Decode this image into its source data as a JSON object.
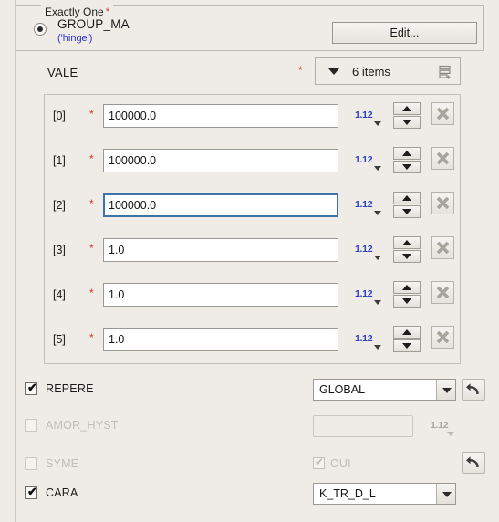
{
  "group": {
    "legend": "Exactly One",
    "legend_required": "*",
    "radio_label": "GROUP_MA",
    "radio_sublabel": "('hinge')",
    "radio_selected": true,
    "edit_button": "Edit..."
  },
  "vale": {
    "label": "VALE",
    "required": "*",
    "count_text": "6 items",
    "list_icon": "list-add-icon",
    "dropdown_icon": "triangle-down-icon"
  },
  "list": {
    "required_marker": "*",
    "type_badge": "1.12",
    "delete_icon": "x-icon",
    "rows": [
      {
        "index": "[0]",
        "value": "100000.0",
        "focused": false
      },
      {
        "index": "[1]",
        "value": "100000.0",
        "focused": false
      },
      {
        "index": "[2]",
        "value": "100000.0",
        "focused": true
      },
      {
        "index": "[3]",
        "value": "1.0",
        "focused": false
      },
      {
        "index": "[4]",
        "value": "1.0",
        "focused": false
      },
      {
        "index": "[5]",
        "value": "1.0",
        "focused": false
      }
    ]
  },
  "options": [
    {
      "name": "REPERE",
      "checked": true,
      "enabled": true,
      "control": "combo",
      "value": "GLOBAL",
      "has_undo": true
    },
    {
      "name": "AMOR_HYST",
      "checked": false,
      "enabled": false,
      "control": "field",
      "value": "",
      "type_badge": "1.12",
      "has_undo": false
    },
    {
      "name": "SYME",
      "checked": false,
      "enabled": false,
      "control": "checkbox",
      "value": "OUI",
      "value_checked": true,
      "has_undo": true
    },
    {
      "name": "CARA",
      "checked": true,
      "enabled": true,
      "control": "combo",
      "value": "K_TR_D_L",
      "has_undo": false
    }
  ],
  "colors": {
    "background": "#efece7",
    "required_star": "#d8342a",
    "link_blue": "#2b31c4",
    "badge_blue": "#2b3fbd",
    "focus_border": "#3f72a8"
  },
  "icons": {
    "check": "✔",
    "undo": "undo-arrow-icon"
  }
}
